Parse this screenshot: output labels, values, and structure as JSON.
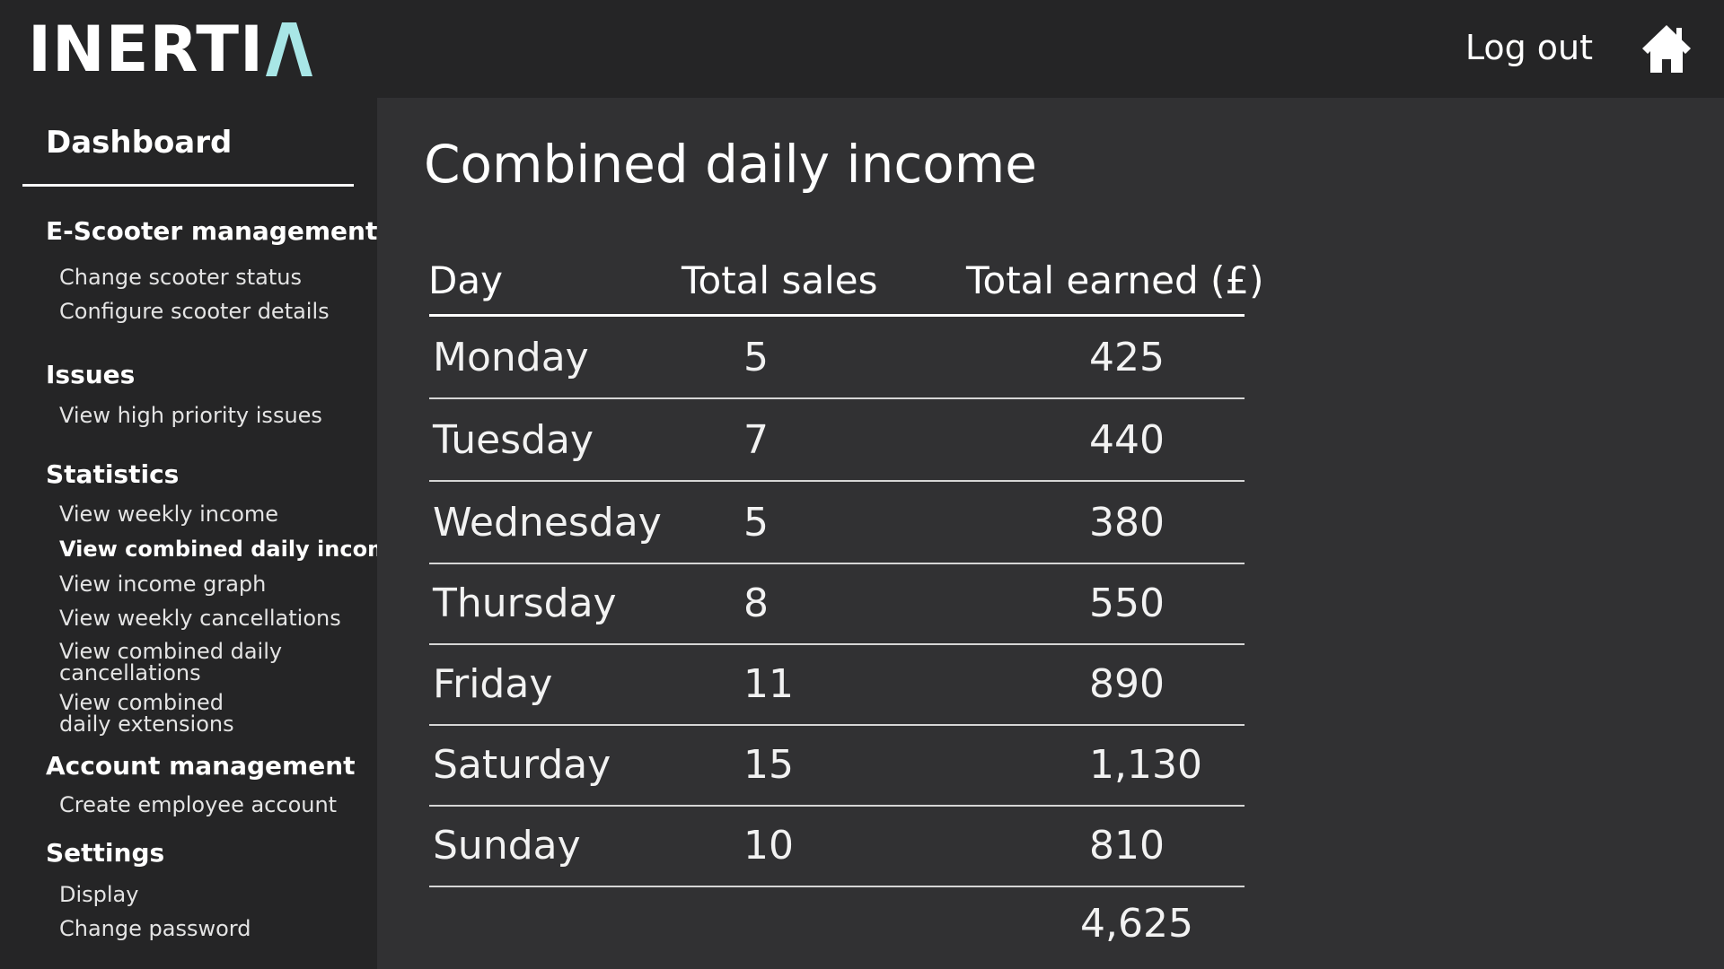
{
  "header": {
    "logo_text": "INERTI",
    "logo_accent_color": "#a8e6e6",
    "logout_label": "Log out",
    "home_icon": "home-icon"
  },
  "sidebar": {
    "title": "Dashboard",
    "sections": [
      {
        "heading": "E-Scooter management",
        "items": [
          "Change scooter status",
          "Configure scooter details"
        ]
      },
      {
        "heading": "Issues",
        "items": [
          "View high priority issues"
        ]
      },
      {
        "heading": "Statistics",
        "items": [
          "View weekly income",
          "View combined daily income",
          "View income graph",
          "View weekly cancellations",
          "View combined daily cancellations",
          "View combined daily extensions"
        ]
      },
      {
        "heading": "Account management",
        "items": [
          "Create employee account"
        ]
      },
      {
        "heading": "Settings",
        "items": [
          "Display",
          "Change password"
        ]
      }
    ],
    "active_item": "View combined daily income"
  },
  "main": {
    "title": "Combined daily income",
    "table": {
      "headers": [
        "Day",
        "Total sales",
        "Total earned (£)"
      ],
      "rows": [
        [
          "Monday",
          "5",
          "425"
        ],
        [
          "Tuesday",
          "7",
          "440"
        ],
        [
          "Wednesday",
          "5",
          "380"
        ],
        [
          "Thursday",
          "8",
          "550"
        ],
        [
          "Friday",
          "11",
          "890"
        ],
        [
          "Saturday",
          "15",
          "1,130"
        ],
        [
          "Sunday",
          "10",
          "810"
        ]
      ],
      "total_earned": "4,625"
    }
  }
}
